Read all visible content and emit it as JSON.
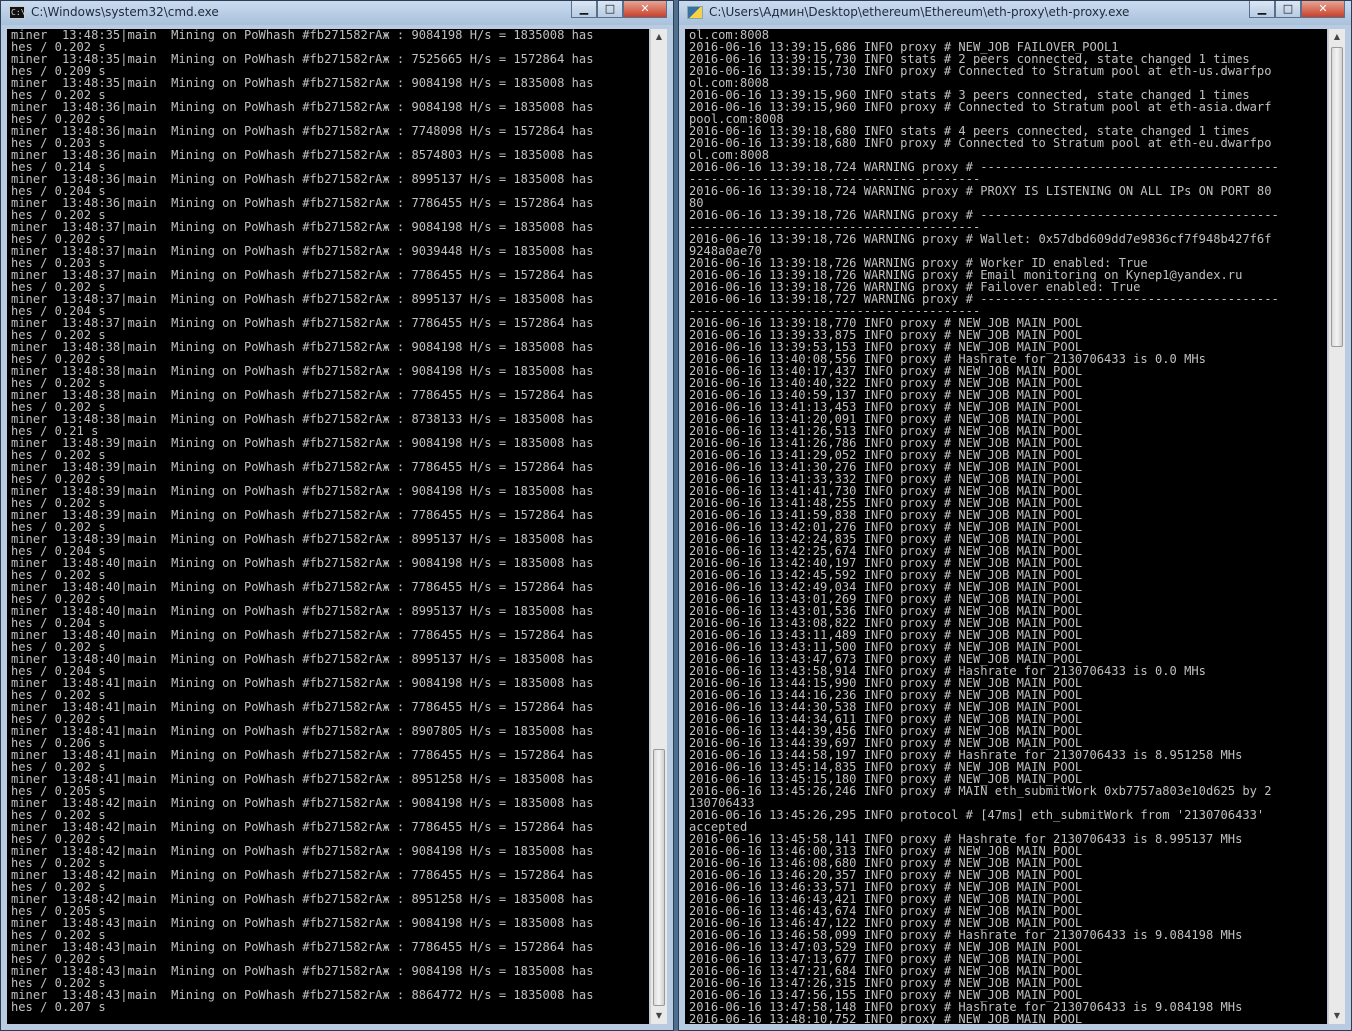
{
  "left_window": {
    "title": "C:\\Windows\\system32\\cmd.exe",
    "icon": "cmd-icon",
    "controls": {
      "minimize": "▁",
      "maximize": "□",
      "close": "✕"
    },
    "lines": [
      "miner  13:48:35|main  Mining on PoWhash #fb271582rAж : 9084198 H/s = 1835008 has",
      "hes / 0.202 s",
      "miner  13:48:35|main  Mining on PoWhash #fb271582rAж : 7525665 H/s = 1572864 has",
      "hes / 0.209 s",
      "miner  13:48:35|main  Mining on PoWhash #fb271582rAж : 9084198 H/s = 1835008 has",
      "hes / 0.202 s",
      "miner  13:48:36|main  Mining on PoWhash #fb271582rAж : 9084198 H/s = 1835008 has",
      "hes / 0.202 s",
      "miner  13:48:36|main  Mining on PoWhash #fb271582rAж : 7748098 H/s = 1572864 has",
      "hes / 0.203 s",
      "miner  13:48:36|main  Mining on PoWhash #fb271582rAж : 8574803 H/s = 1835008 has",
      "hes / 0.214 s",
      "miner  13:48:36|main  Mining on PoWhash #fb271582rAж : 8995137 H/s = 1835008 has",
      "hes / 0.204 s",
      "miner  13:48:36|main  Mining on PoWhash #fb271582rAж : 7786455 H/s = 1572864 has",
      "hes / 0.202 s",
      "miner  13:48:37|main  Mining on PoWhash #fb271582rAж : 9084198 H/s = 1835008 has",
      "hes / 0.202 s",
      "miner  13:48:37|main  Mining on PoWhash #fb271582rAж : 9039448 H/s = 1835008 has",
      "hes / 0.203 s",
      "miner  13:48:37|main  Mining on PoWhash #fb271582rAж : 7786455 H/s = 1572864 has",
      "hes / 0.202 s",
      "miner  13:48:37|main  Mining on PoWhash #fb271582rAж : 8995137 H/s = 1835008 has",
      "hes / 0.204 s",
      "miner  13:48:37|main  Mining on PoWhash #fb271582rAж : 7786455 H/s = 1572864 has",
      "hes / 0.202 s",
      "miner  13:48:38|main  Mining on PoWhash #fb271582rAж : 9084198 H/s = 1835008 has",
      "hes / 0.202 s",
      "miner  13:48:38|main  Mining on PoWhash #fb271582rAж : 9084198 H/s = 1835008 has",
      "hes / 0.202 s",
      "miner  13:48:38|main  Mining on PoWhash #fb271582rAж : 7786455 H/s = 1572864 has",
      "hes / 0.202 s",
      "miner  13:48:38|main  Mining on PoWhash #fb271582rAж : 8738133 H/s = 1835008 has",
      "hes / 0.21 s",
      "miner  13:48:39|main  Mining on PoWhash #fb271582rAж : 9084198 H/s = 1835008 has",
      "hes / 0.202 s",
      "miner  13:48:39|main  Mining on PoWhash #fb271582rAж : 7786455 H/s = 1572864 has",
      "hes / 0.202 s",
      "miner  13:48:39|main  Mining on PoWhash #fb271582rAж : 9084198 H/s = 1835008 has",
      "hes / 0.202 s",
      "miner  13:48:39|main  Mining on PoWhash #fb271582rAж : 7786455 H/s = 1572864 has",
      "hes / 0.202 s",
      "miner  13:48:39|main  Mining on PoWhash #fb271582rAж : 8995137 H/s = 1835008 has",
      "hes / 0.204 s",
      "miner  13:48:40|main  Mining on PoWhash #fb271582rAж : 9084198 H/s = 1835008 has",
      "hes / 0.202 s",
      "miner  13:48:40|main  Mining on PoWhash #fb271582rAж : 7786455 H/s = 1572864 has",
      "hes / 0.202 s",
      "miner  13:48:40|main  Mining on PoWhash #fb271582rAж : 8995137 H/s = 1835008 has",
      "hes / 0.204 s",
      "miner  13:48:40|main  Mining on PoWhash #fb271582rAж : 7786455 H/s = 1572864 has",
      "hes / 0.202 s",
      "miner  13:48:40|main  Mining on PoWhash #fb271582rAж : 8995137 H/s = 1835008 has",
      "hes / 0.204 s",
      "miner  13:48:41|main  Mining on PoWhash #fb271582rAж : 9084198 H/s = 1835008 has",
      "hes / 0.202 s",
      "miner  13:48:41|main  Mining on PoWhash #fb271582rAж : 7786455 H/s = 1572864 has",
      "hes / 0.202 s",
      "miner  13:48:41|main  Mining on PoWhash #fb271582rAж : 8907805 H/s = 1835008 has",
      "hes / 0.206 s",
      "miner  13:48:41|main  Mining on PoWhash #fb271582rAж : 7786455 H/s = 1572864 has",
      "hes / 0.202 s",
      "miner  13:48:41|main  Mining on PoWhash #fb271582rAж : 8951258 H/s = 1835008 has",
      "hes / 0.205 s",
      "miner  13:48:42|main  Mining on PoWhash #fb271582rAж : 9084198 H/s = 1835008 has",
      "hes / 0.202 s",
      "miner  13:48:42|main  Mining on PoWhash #fb271582rAж : 7786455 H/s = 1572864 has",
      "hes / 0.202 s",
      "miner  13:48:42|main  Mining on PoWhash #fb271582rAж : 9084198 H/s = 1835008 has",
      "hes / 0.202 s",
      "miner  13:48:42|main  Mining on PoWhash #fb271582rAж : 7786455 H/s = 1572864 has",
      "hes / 0.202 s",
      "miner  13:48:42|main  Mining on PoWhash #fb271582rAж : 8951258 H/s = 1835008 has",
      "hes / 0.205 s",
      "miner  13:48:43|main  Mining on PoWhash #fb271582rAж : 9084198 H/s = 1835008 has",
      "hes / 0.202 s",
      "miner  13:48:43|main  Mining on PoWhash #fb271582rAж : 7786455 H/s = 1572864 has",
      "hes / 0.202 s",
      "miner  13:48:43|main  Mining on PoWhash #fb271582rAж : 9084198 H/s = 1835008 has",
      "hes / 0.202 s",
      "miner  13:48:43|main  Mining on PoWhash #fb271582rAж : 8864772 H/s = 1835008 has",
      "hes / 0.207 s"
    ]
  },
  "right_window": {
    "title": "C:\\Users\\Админ\\Desktop\\ethereum\\Ethereum\\eth-proxy\\eth-proxy.exe",
    "icon": "python-icon",
    "controls": {
      "minimize": "▁",
      "maximize": "□",
      "close": "✕"
    },
    "lines": [
      "ol.com:8008",
      "2016-06-16 13:39:15,686 INFO proxy # NEW_JOB FAILOVER_POOL1",
      "2016-06-16 13:39:15,730 INFO stats # 2 peers connected, state changed 1 times",
      "2016-06-16 13:39:15,730 INFO proxy # Connected to Stratum pool at eth-us.dwarfpo",
      "ol.com:8008",
      "2016-06-16 13:39:15,960 INFO stats # 3 peers connected, state changed 1 times",
      "2016-06-16 13:39:15,960 INFO proxy # Connected to Stratum pool at eth-asia.dwarf",
      "pool.com:8008",
      "2016-06-16 13:39:18,680 INFO stats # 4 peers connected, state changed 1 times",
      "2016-06-16 13:39:18,680 INFO proxy # Connected to Stratum pool at eth-eu.dwarfpo",
      "ol.com:8008",
      "2016-06-16 13:39:18,724 WARNING proxy # -----------------------------------------",
      "----------------------------------------",
      "2016-06-16 13:39:18,724 WARNING proxy # PROXY IS LISTENING ON ALL IPs ON PORT 80",
      "80",
      "2016-06-16 13:39:18,726 WARNING proxy # -----------------------------------------",
      "----------------------------------------",
      "2016-06-16 13:39:18,726 WARNING proxy # Wallet: 0x57dbd609dd7e9836cf7f948b427f6f",
      "9248a0ae70",
      "2016-06-16 13:39:18,726 WARNING proxy # Worker ID enabled: True",
      "2016-06-16 13:39:18,726 WARNING proxy # Email monitoring on Kynep1@yandex.ru",
      "2016-06-16 13:39:18,726 WARNING proxy # Failover enabled: True",
      "2016-06-16 13:39:18,727 WARNING proxy # -----------------------------------------",
      "----------------------------------------",
      "2016-06-16 13:39:18,770 INFO proxy # NEW_JOB MAIN_POOL",
      "2016-06-16 13:39:33,875 INFO proxy # NEW_JOB MAIN_POOL",
      "2016-06-16 13:39:53,153 INFO proxy # NEW_JOB MAIN_POOL",
      "2016-06-16 13:40:08,556 INFO proxy # Hashrate for 2130706433 is 0.0 MHs",
      "2016-06-16 13:40:17,437 INFO proxy # NEW_JOB MAIN_POOL",
      "2016-06-16 13:40:40,322 INFO proxy # NEW_JOB MAIN_POOL",
      "2016-06-16 13:40:59,137 INFO proxy # NEW_JOB MAIN_POOL",
      "2016-06-16 13:41:13,453 INFO proxy # NEW_JOB MAIN_POOL",
      "2016-06-16 13:41:20,091 INFO proxy # NEW_JOB MAIN_POOL",
      "2016-06-16 13:41:26,513 INFO proxy # NEW_JOB MAIN_POOL",
      "2016-06-16 13:41:26,786 INFO proxy # NEW_JOB MAIN_POOL",
      "2016-06-16 13:41:29,052 INFO proxy # NEW_JOB MAIN_POOL",
      "2016-06-16 13:41:30,276 INFO proxy # NEW_JOB MAIN_POOL",
      "2016-06-16 13:41:33,332 INFO proxy # NEW_JOB MAIN_POOL",
      "2016-06-16 13:41:41,730 INFO proxy # NEW_JOB MAIN_POOL",
      "2016-06-16 13:41:48,255 INFO proxy # NEW_JOB MAIN_POOL",
      "2016-06-16 13:41:59,838 INFO proxy # NEW_JOB MAIN_POOL",
      "2016-06-16 13:42:01,276 INFO proxy # NEW_JOB MAIN_POOL",
      "2016-06-16 13:42:24,835 INFO proxy # NEW_JOB MAIN_POOL",
      "2016-06-16 13:42:25,674 INFO proxy # NEW_JOB MAIN_POOL",
      "2016-06-16 13:42:40,197 INFO proxy # NEW_JOB MAIN_POOL",
      "2016-06-16 13:42:45,592 INFO proxy # NEW_JOB MAIN_POOL",
      "2016-06-16 13:42:49,034 INFO proxy # NEW_JOB MAIN_POOL",
      "2016-06-16 13:43:01,269 INFO proxy # NEW_JOB MAIN_POOL",
      "2016-06-16 13:43:01,536 INFO proxy # NEW_JOB MAIN_POOL",
      "2016-06-16 13:43:08,822 INFO proxy # NEW_JOB MAIN_POOL",
      "2016-06-16 13:43:11,489 INFO proxy # NEW_JOB MAIN_POOL",
      "2016-06-16 13:43:11,500 INFO proxy # NEW_JOB MAIN_POOL",
      "2016-06-16 13:43:47,673 INFO proxy # NEW_JOB MAIN_POOL",
      "2016-06-16 13:43:58,914 INFO proxy # Hashrate for 2130706433 is 0.0 MHs",
      "2016-06-16 13:44:15,990 INFO proxy # NEW_JOB MAIN_POOL",
      "2016-06-16 13:44:16,236 INFO proxy # NEW_JOB MAIN_POOL",
      "2016-06-16 13:44:30,538 INFO proxy # NEW_JOB MAIN_POOL",
      "2016-06-16 13:44:34,611 INFO proxy # NEW_JOB MAIN_POOL",
      "2016-06-16 13:44:39,456 INFO proxy # NEW_JOB MAIN_POOL",
      "2016-06-16 13:44:39,697 INFO proxy # NEW_JOB MAIN_POOL",
      "2016-06-16 13:44:58,197 INFO proxy # Hashrate for 2130706433 is 8.951258 MHs",
      "2016-06-16 13:45:14,835 INFO proxy # NEW_JOB MAIN_POOL",
      "2016-06-16 13:45:15,180 INFO proxy # NEW_JOB MAIN_POOL",
      "2016-06-16 13:45:26,246 INFO proxy # MAIN eth_submitWork 0xb7757a803e10d625 by 2",
      "130706433",
      "2016-06-16 13:45:26,295 INFO protocol # [47ms] eth_submitWork from '2130706433'",
      "accepted",
      "2016-06-16 13:45:58,141 INFO proxy # Hashrate for 2130706433 is 8.995137 MHs",
      "2016-06-16 13:46:00,313 INFO proxy # NEW_JOB MAIN_POOL",
      "2016-06-16 13:46:08,680 INFO proxy # NEW_JOB MAIN_POOL",
      "2016-06-16 13:46:20,357 INFO proxy # NEW_JOB MAIN_POOL",
      "2016-06-16 13:46:33,571 INFO proxy # NEW_JOB MAIN_POOL",
      "2016-06-16 13:46:43,421 INFO proxy # NEW_JOB MAIN_POOL",
      "2016-06-16 13:46:43,674 INFO proxy # NEW_JOB MAIN_POOL",
      "2016-06-16 13:46:47,122 INFO proxy # NEW_JOB MAIN_POOL",
      "2016-06-16 13:46:58,099 INFO proxy # Hashrate for 2130706433 is 9.084198 MHs",
      "2016-06-16 13:47:03,529 INFO proxy # NEW_JOB MAIN_POOL",
      "2016-06-16 13:47:13,677 INFO proxy # NEW_JOB MAIN_POOL",
      "2016-06-16 13:47:21,684 INFO proxy # NEW_JOB MAIN_POOL",
      "2016-06-16 13:47:26,315 INFO proxy # NEW_JOB MAIN_POOL",
      "2016-06-16 13:47:56,155 INFO proxy # NEW_JOB MAIN_POOL",
      "2016-06-16 13:47:58,148 INFO proxy # Hashrate for 2130706433 is 9.084198 MHs",
      "2016-06-16 13:48:10,752 INFO proxy # NEW_JOB MAIN_POOL"
    ]
  }
}
